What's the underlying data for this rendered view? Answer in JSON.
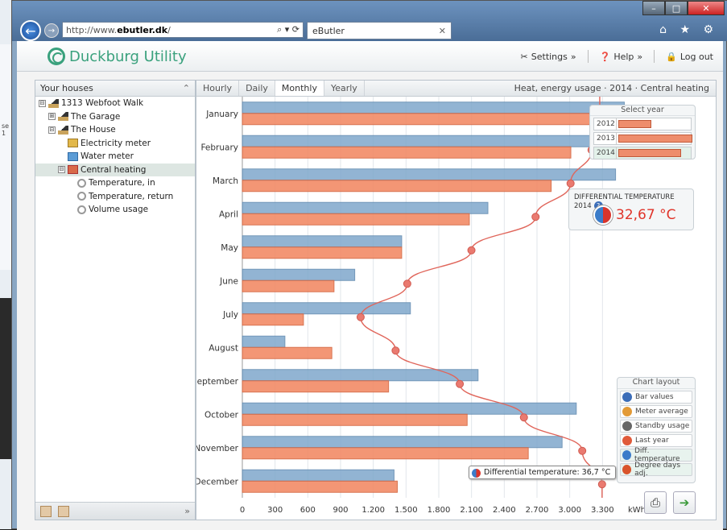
{
  "background": {
    "left_text": "se\nr 1"
  },
  "browser": {
    "address_prefix": "http://www.",
    "address_domain": "ebutler.dk",
    "address_suffix": "/",
    "address_controls": "⌕ ▾ ⟳",
    "tab_title": "eButler",
    "window_buttons": [
      "–",
      "□",
      "✕"
    ],
    "toolbar_icons": "⌂ ★ ⚙"
  },
  "header": {
    "logo_text": "Duckburg Utility",
    "settings_label": "Settings",
    "help_label": "Help",
    "logout_label": "Log out"
  },
  "sidebar": {
    "title": "Your houses",
    "collapse_icon": "⌃",
    "items": [
      {
        "label": "1313 Webfoot Walk",
        "level": 0,
        "toggle": "⊟",
        "icon": "house"
      },
      {
        "label": "The Garage",
        "level": 1,
        "toggle": "⊞",
        "icon": "house"
      },
      {
        "label": "The House",
        "level": 1,
        "toggle": "⊟",
        "icon": "house"
      },
      {
        "label": "Electricity meter",
        "level": 2,
        "toggle": "",
        "icon": "meter"
      },
      {
        "label": "Water meter",
        "level": 2,
        "toggle": "",
        "icon": "water"
      },
      {
        "label": "Central heating",
        "level": 2,
        "toggle": "⊟",
        "icon": "heat",
        "selected": true
      },
      {
        "label": "Temperature, in",
        "level": 3,
        "toggle": "",
        "icon": "gear"
      },
      {
        "label": "Temperature, return",
        "level": 3,
        "toggle": "",
        "icon": "gear"
      },
      {
        "label": "Volume usage",
        "level": 3,
        "toggle": "",
        "icon": "gear"
      }
    ],
    "footer_expand": "»"
  },
  "main": {
    "tabs": [
      {
        "label": "Hourly",
        "active": false
      },
      {
        "label": "Daily",
        "active": false
      },
      {
        "label": "Monthly",
        "active": true
      },
      {
        "label": "Yearly",
        "active": false
      }
    ],
    "chart_title": "Heat, energy usage · 2014 · Central heating"
  },
  "year_selector": {
    "title": "Select year",
    "years": [
      {
        "label": "2012",
        "value": 0.45
      },
      {
        "label": "2013",
        "value": 1.0
      },
      {
        "label": "2014",
        "value": 0.85,
        "selected": true
      }
    ]
  },
  "diff_temp": {
    "title": "DIFFERENTIAL TEMPERATURE 2014",
    "help_icon": "?",
    "value": "32,67 °C"
  },
  "chart_layout": {
    "title": "Chart layout",
    "items": [
      {
        "label": "Bar values",
        "color": "#3b6db8"
      },
      {
        "label": "Meter average",
        "color": "#e39a36"
      },
      {
        "label": "Standby usage",
        "color": "#666"
      },
      {
        "label": "Last year",
        "color": "#e05a3a"
      },
      {
        "label": "Diff. temperature",
        "color": "#3b7cc9",
        "active": true
      },
      {
        "label": "Degree days adj.",
        "color": "#d9542b",
        "active": true
      }
    ]
  },
  "tooltip": {
    "text": "Differential temperature: 36,7 °C"
  },
  "chart_data": {
    "type": "bar",
    "orientation": "horizontal",
    "categories": [
      "January",
      "February",
      "March",
      "April",
      "May",
      "June",
      "July",
      "August",
      "September",
      "October",
      "November",
      "December"
    ],
    "series": [
      {
        "values": [
          3500,
          3650,
          3420,
          2250,
          1460,
          1030,
          1540,
          390,
          2160,
          3060,
          2930,
          1390
        ]
      },
      {
        "values": [
          3470,
          3010,
          2830,
          2080,
          1460,
          840,
          560,
          820,
          1340,
          2060,
          2620,
          1420
        ]
      }
    ],
    "line_series": {
      "values": [
        36.5,
        35.8,
        34.0,
        31.0,
        25.5,
        20.0,
        16.0,
        19.0,
        24.5,
        30.0,
        35.0,
        36.7
      ]
    },
    "xlim": [
      0,
      3600
    ],
    "xticks": [
      "0",
      "300",
      "600",
      "900",
      "1.200",
      "1.500",
      "1.800",
      "2.100",
      "2.400",
      "2.700",
      "3.000",
      "3.300"
    ],
    "xunit": "kWh",
    "series_colors": [
      "#7fa8cc",
      "#f28b67"
    ]
  }
}
